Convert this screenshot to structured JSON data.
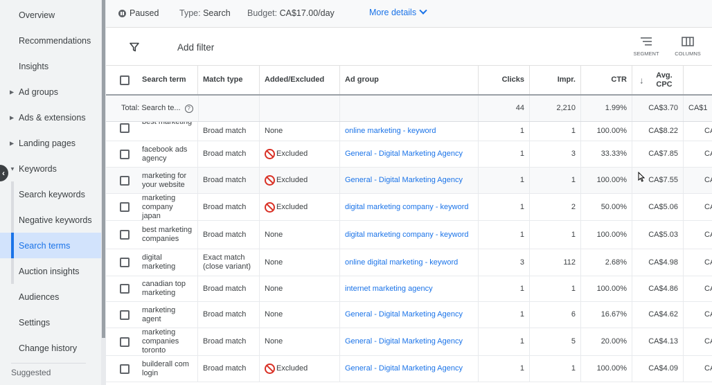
{
  "sidebar": {
    "items": [
      {
        "label": "Overview"
      },
      {
        "label": "Recommendations"
      },
      {
        "label": "Insights"
      },
      {
        "label": "Ad groups"
      },
      {
        "label": "Ads & extensions"
      },
      {
        "label": "Landing pages"
      },
      {
        "label": "Keywords"
      },
      {
        "label": "Search keywords"
      },
      {
        "label": "Negative keywords"
      },
      {
        "label": "Search terms"
      },
      {
        "label": "Auction insights"
      },
      {
        "label": "Audiences"
      },
      {
        "label": "Settings"
      },
      {
        "label": "Change history"
      }
    ],
    "suggested": "Suggested"
  },
  "status": {
    "paused": "Paused",
    "type_label": "Type:",
    "type_value": "Search",
    "budget_label": "Budget:",
    "budget_value": "CA$17.00/day",
    "more_details": "More details"
  },
  "toolbar": {
    "add_filter": "Add filter",
    "segment": "SEGMENT",
    "columns": "COLUMNS"
  },
  "table": {
    "headers": {
      "search_term": "Search term",
      "match_type": "Match type",
      "added_excluded": "Added/Excluded",
      "ad_group": "Ad group",
      "clicks": "Clicks",
      "impr": "Impr.",
      "ctr": "CTR",
      "avg_cpc": "Avg. CPC"
    },
    "total": {
      "label": "Total: Search te...",
      "clicks": "44",
      "impr": "2,210",
      "ctr": "1.99%",
      "avg_cpc": "CA$3.70",
      "next": "CA$1"
    },
    "rows": [
      {
        "term": "best marketing",
        "match": "Broad match",
        "status": "None",
        "ad_group": "online marketing - keyword",
        "clicks": "1",
        "impr": "1",
        "ctr": "100.00%",
        "cpc": "CA$8.22",
        "next": "CA"
      },
      {
        "term": "facebook ads agency",
        "match": "Broad match",
        "status": "Excluded",
        "ad_group": "General - Digital Marketing Agency",
        "clicks": "1",
        "impr": "3",
        "ctr": "33.33%",
        "cpc": "CA$7.85",
        "next": "CA"
      },
      {
        "term": "marketing for your website",
        "match": "Broad match",
        "status": "Excluded",
        "ad_group": "General - Digital Marketing Agency",
        "clicks": "1",
        "impr": "1",
        "ctr": "100.00%",
        "cpc": "CA$7.55",
        "next": "CA"
      },
      {
        "term": "marketing company japan",
        "match": "Broad match",
        "status": "Excluded",
        "ad_group": "digital marketing company - keyword",
        "clicks": "1",
        "impr": "2",
        "ctr": "50.00%",
        "cpc": "CA$5.06",
        "next": "CA"
      },
      {
        "term": "best marketing companies",
        "match": "Broad match",
        "status": "None",
        "ad_group": "digital marketing company - keyword",
        "clicks": "1",
        "impr": "1",
        "ctr": "100.00%",
        "cpc": "CA$5.03",
        "next": "CA"
      },
      {
        "term": "digital marketing",
        "match": "Exact match (close variant)",
        "status": "None",
        "ad_group": "online digital marketing - keyword",
        "clicks": "3",
        "impr": "112",
        "ctr": "2.68%",
        "cpc": "CA$4.98",
        "next": "CA$"
      },
      {
        "term": "canadian top marketing",
        "match": "Broad match",
        "status": "None",
        "ad_group": "internet marketing agency",
        "clicks": "1",
        "impr": "1",
        "ctr": "100.00%",
        "cpc": "CA$4.86",
        "next": "CA"
      },
      {
        "term": "marketing agent",
        "match": "Broad match",
        "status": "None",
        "ad_group": "General - Digital Marketing Agency",
        "clicks": "1",
        "impr": "6",
        "ctr": "16.67%",
        "cpc": "CA$4.62",
        "next": "CA"
      },
      {
        "term": "marketing companies toronto",
        "match": "Broad match",
        "status": "None",
        "ad_group": "General - Digital Marketing Agency",
        "clicks": "1",
        "impr": "5",
        "ctr": "20.00%",
        "cpc": "CA$4.13",
        "next": "CA"
      },
      {
        "term": "builderall com login",
        "match": "Broad match",
        "status": "Excluded",
        "ad_group": "General - Digital Marketing Agency",
        "clicks": "1",
        "impr": "1",
        "ctr": "100.00%",
        "cpc": "CA$4.09",
        "next": "CA"
      }
    ]
  }
}
